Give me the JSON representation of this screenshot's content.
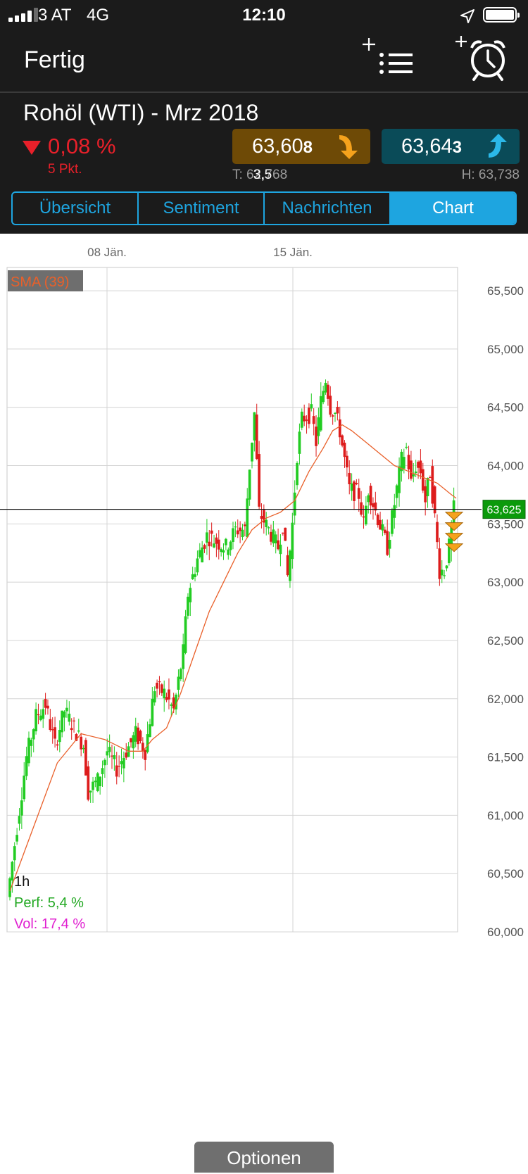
{
  "status": {
    "carrier": "3 AT",
    "network": "4G",
    "time": "12:10"
  },
  "nav": {
    "done_label": "Fertig",
    "list_icon": "add-list-icon",
    "alarm_icon": "add-alarm-icon"
  },
  "instrument": {
    "name": "Rohöl (WTI) - Mrz 2018",
    "change_pct": "0,08 %",
    "change_pts": "5 Pkt.",
    "sell_main": "63,60",
    "sell_last": "8",
    "buy_main": "63,64",
    "buy_last": "3",
    "low": "T: 62,768",
    "spread": "3,5",
    "high": "H: 63,738",
    "colors": {
      "down": "#e8202a",
      "sell_bg": "#6e4a06",
      "buy_bg": "#0a4b58",
      "accent": "#1ea5e0"
    }
  },
  "tabs": [
    {
      "label": "Übersicht",
      "active": false
    },
    {
      "label": "Sentiment",
      "active": false
    },
    {
      "label": "Nachrichten",
      "active": false
    },
    {
      "label": "Chart",
      "active": true
    }
  ],
  "chart_data": {
    "type": "candlestick",
    "indicator": "SMA (39)",
    "x_labels": [
      "08 Jän.",
      "15 Jän."
    ],
    "y_ticks": [
      "65,500",
      "65,000",
      "64,500",
      "64,000",
      "63,500",
      "63,000",
      "62,500",
      "62,000",
      "61,500",
      "61,000",
      "60,500",
      "60,000"
    ],
    "ylim": [
      60.0,
      65.5
    ],
    "current_price_label": "63,625",
    "current_price": 63.625,
    "timeframe": "1h",
    "perf": "Perf: 5,4 %",
    "vol": "Vol: 17,4 %",
    "grid": true,
    "close_path": [
      [
        0,
        60.3
      ],
      [
        2,
        60.9
      ],
      [
        4,
        61.5
      ],
      [
        6,
        61.85
      ],
      [
        8,
        61.95
      ],
      [
        10,
        61.6
      ],
      [
        12,
        61.9
      ],
      [
        14,
        61.75
      ],
      [
        16,
        61.6
      ],
      [
        17,
        61.2
      ],
      [
        19,
        61.3
      ],
      [
        21,
        61.55
      ],
      [
        23,
        61.4
      ],
      [
        25,
        61.55
      ],
      [
        27,
        61.7
      ],
      [
        29,
        61.55
      ],
      [
        31,
        62.1
      ],
      [
        33,
        62.05
      ],
      [
        35,
        61.9
      ],
      [
        37,
        62.4
      ],
      [
        38,
        62.9
      ],
      [
        40,
        63.2
      ],
      [
        42,
        63.4
      ],
      [
        44,
        63.35
      ],
      [
        46,
        63.3
      ],
      [
        48,
        63.45
      ],
      [
        50,
        63.45
      ],
      [
        51,
        64.0
      ],
      [
        52,
        64.45
      ],
      [
        53,
        63.6
      ],
      [
        55,
        63.45
      ],
      [
        57,
        63.3
      ],
      [
        58,
        63.5
      ],
      [
        59,
        63.05
      ],
      [
        60,
        63.5
      ],
      [
        61,
        64.1
      ],
      [
        62,
        64.4
      ],
      [
        64,
        64.45
      ],
      [
        65,
        64.2
      ],
      [
        66,
        64.55
      ],
      [
        67,
        64.75
      ],
      [
        68,
        64.5
      ],
      [
        69,
        64.45
      ],
      [
        70,
        64.3
      ],
      [
        71,
        64.05
      ],
      [
        72,
        63.8
      ],
      [
        74,
        63.75
      ],
      [
        75,
        63.5
      ],
      [
        76,
        63.8
      ],
      [
        78,
        63.55
      ],
      [
        80,
        63.3
      ],
      [
        82,
        63.8
      ],
      [
        83,
        64.05
      ],
      [
        84,
        64.15
      ],
      [
        85,
        63.85
      ],
      [
        86,
        64.0
      ],
      [
        87,
        63.95
      ],
      [
        88,
        63.7
      ],
      [
        89,
        63.95
      ],
      [
        90,
        63.55
      ],
      [
        91,
        63.1
      ],
      [
        92,
        63.1
      ],
      [
        93,
        63.3
      ],
      [
        94,
        63.625
      ]
    ],
    "sma_path": [
      [
        0,
        60.35
      ],
      [
        5,
        60.9
      ],
      [
        10,
        61.45
      ],
      [
        15,
        61.7
      ],
      [
        20,
        61.65
      ],
      [
        25,
        61.55
      ],
      [
        28,
        61.55
      ],
      [
        30,
        61.65
      ],
      [
        33,
        61.75
      ],
      [
        36,
        62.05
      ],
      [
        39,
        62.4
      ],
      [
        42,
        62.75
      ],
      [
        45,
        63.0
      ],
      [
        48,
        63.25
      ],
      [
        51,
        63.45
      ],
      [
        54,
        63.55
      ],
      [
        57,
        63.6
      ],
      [
        60,
        63.7
      ],
      [
        63,
        63.95
      ],
      [
        66,
        64.15
      ],
      [
        68,
        64.3
      ],
      [
        70,
        64.35
      ],
      [
        72,
        64.3
      ],
      [
        75,
        64.2
      ],
      [
        78,
        64.1
      ],
      [
        81,
        64.0
      ],
      [
        84,
        63.95
      ],
      [
        87,
        63.9
      ],
      [
        90,
        63.85
      ],
      [
        93,
        63.75
      ],
      [
        94,
        63.72
      ]
    ]
  },
  "options_label": "Optionen"
}
